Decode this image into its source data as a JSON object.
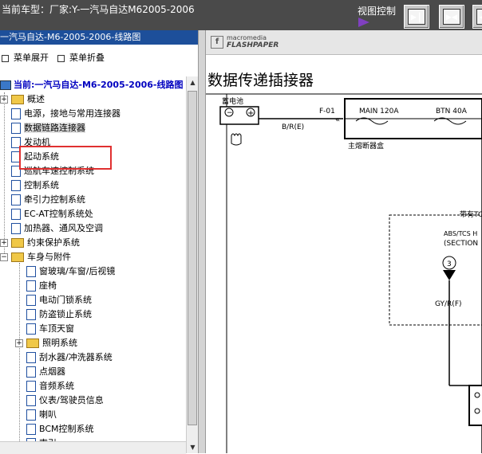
{
  "topbar": {
    "current_model": "当前车型：厂家:Y-一汽马自达M62005-2006",
    "view_control_label": "视图控制",
    "buttons": [
      {
        "symbol": "▶|",
        "name": "expand-right"
      },
      {
        "symbol": "▶◀",
        "name": "collapse"
      },
      {
        "symbol": "◀|",
        "name": "expand-left"
      }
    ]
  },
  "left_panel": {
    "header": "一汽马自达-M6-2005-2006-线路图",
    "menu_expand": "菜单展开",
    "menu_collapse": "菜单折叠",
    "root_label": "当前:一汽马自达-M6-2005-2006-线路图",
    "tree_items": [
      {
        "label": "概述",
        "type": "folder",
        "expand": "+"
      },
      {
        "label": "电源，接地与常用连接器",
        "type": "doc"
      },
      {
        "label": "数据链路连接器",
        "type": "doc",
        "selected": true
      },
      {
        "label": "发动机",
        "type": "doc"
      },
      {
        "label": "起动系统",
        "type": "doc"
      },
      {
        "label": "巡航车速控制系统",
        "type": "doc"
      },
      {
        "label": "控制系统",
        "type": "doc"
      },
      {
        "label": "牵引力控制系统",
        "type": "doc"
      },
      {
        "label": "EC-AT控制系统处",
        "type": "doc"
      },
      {
        "label": "加热器、通风及空调",
        "type": "doc"
      },
      {
        "label": "约束保护系统",
        "type": "folder",
        "expand": "+"
      },
      {
        "label": "车身与附件",
        "type": "folder-open",
        "expand": "−"
      },
      {
        "label": "窗玻璃/车窗/后视镜",
        "type": "doc",
        "indent": 1
      },
      {
        "label": "座椅",
        "type": "doc",
        "indent": 1
      },
      {
        "label": "电动门锁系统",
        "type": "doc",
        "indent": 1
      },
      {
        "label": "防盗锁止系统",
        "type": "doc",
        "indent": 1
      },
      {
        "label": "车顶天窗",
        "type": "doc",
        "indent": 1
      },
      {
        "label": "照明系统",
        "type": "folder",
        "indent": 1,
        "expand": "+"
      },
      {
        "label": "刮水器/冲洗器系统",
        "type": "doc",
        "indent": 1
      },
      {
        "label": "点烟器",
        "type": "doc",
        "indent": 1
      },
      {
        "label": "音频系统",
        "type": "doc",
        "indent": 1
      },
      {
        "label": "仪表/驾驶员信息",
        "type": "doc",
        "indent": 1
      },
      {
        "label": "喇叭",
        "type": "doc",
        "indent": 1
      },
      {
        "label": "BCM控制系统",
        "type": "doc",
        "indent": 1
      },
      {
        "label": "索引",
        "type": "doc",
        "indent": 1
      }
    ]
  },
  "viewer": {
    "brand_top": "macromedia",
    "brand_bottom": "FLASHPAPER",
    "page_title": "数据传递插接器",
    "diagram": {
      "battery_label": "蓄电池",
      "battery_minus": "−",
      "battery_plus": "+",
      "wire_label": "B/R(E)",
      "fuse_ref": "F-01",
      "main_fuse": "MAIN 120A",
      "btn_fuse": "BTN 40A",
      "fuse_box_label": "主熔断器盒",
      "tcs_label": "带有TC",
      "abs_label": "ABS/TCS H",
      "section_label": "(SECTION",
      "connector_num": "3",
      "wire2_label": "GY/R(F)"
    }
  },
  "colors": {
    "topbar_bg": "#4a4a4a",
    "header_blue": "#1d4f9a",
    "highlight_red": "#e03030",
    "root_blue": "#0000c0"
  }
}
